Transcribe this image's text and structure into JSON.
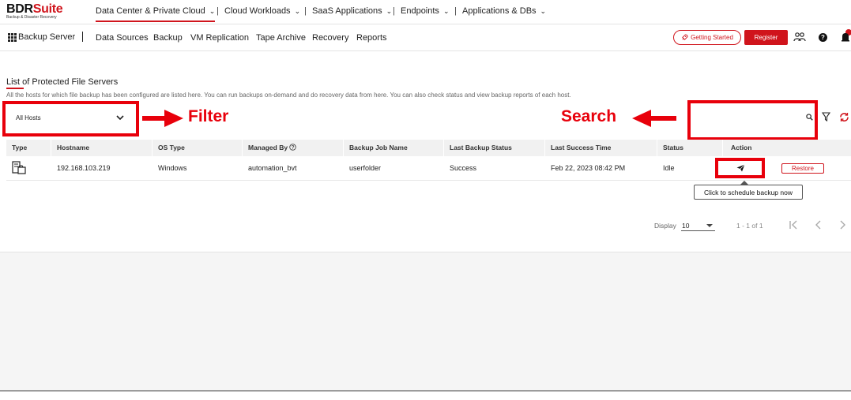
{
  "brand": {
    "name_bold": "BDR",
    "name_accent": "Suite",
    "subtitle": "Backup & Disaster Recovery"
  },
  "products": [
    {
      "label": "Data Center & Private Cloud",
      "active": true
    },
    {
      "label": "Cloud Workloads",
      "active": false
    },
    {
      "label": "SaaS Applications",
      "active": false
    },
    {
      "label": "Endpoints",
      "active": false
    },
    {
      "label": "Applications & DBs",
      "active": false
    }
  ],
  "subnav": {
    "server_label": "Backup Server",
    "tabs": [
      "Data Sources",
      "Backup",
      "VM Replication",
      "Tape Archive",
      "Recovery",
      "Reports"
    ],
    "getting_started": "Getting Started",
    "register": "Register"
  },
  "page": {
    "title": "List of Protected File Servers",
    "description": "All the hosts for which file backup has been configured are listed here. You can run backups on-demand and do recovery data from here. You can also check status and view backup reports of each host."
  },
  "filter": {
    "selected": "All Hosts"
  },
  "search": {
    "value": "",
    "placeholder": ""
  },
  "annotations": {
    "filter_label": "Filter",
    "search_label": "Search",
    "color": "#e8000b"
  },
  "table": {
    "columns": [
      "Type",
      "Hostname",
      "OS Type",
      "Managed By",
      "Backup Job Name",
      "Last Backup Status",
      "Last Success Time",
      "Status",
      "Action"
    ],
    "rows": [
      {
        "type_icon": "file-server-icon",
        "hostname": "192.168.103.219",
        "os_type": "Windows",
        "managed_by": "automation_bvt",
        "backup_job_name": "userfolder",
        "last_backup_status": "Success",
        "last_success_time": "Feb 22, 2023 08:42 PM",
        "status": "Idle",
        "restore_label": "Restore"
      }
    ]
  },
  "tooltip": "Click to schedule backup now",
  "pagination": {
    "display_label": "Display",
    "page_size": "10",
    "range": "1 - 1 of 1"
  },
  "colors": {
    "accent": "#d0141c"
  }
}
